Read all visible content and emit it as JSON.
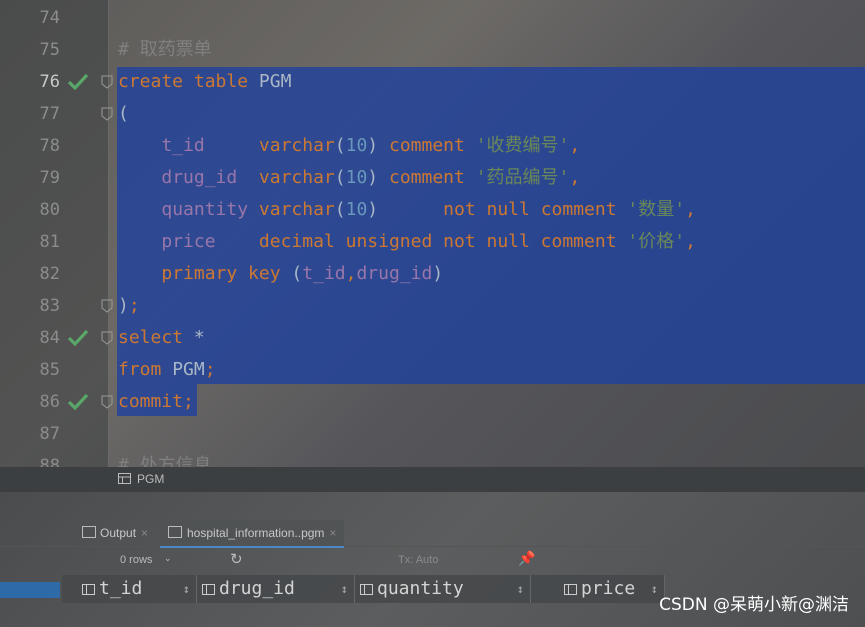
{
  "editor": {
    "lines": [
      {
        "num": "74",
        "tokens": []
      },
      {
        "num": "75",
        "tokens": [
          {
            "t": "# 取药票单",
            "c": "cmt"
          }
        ]
      },
      {
        "num": "76",
        "tokens": [
          {
            "t": "create",
            "c": "kw"
          },
          {
            "t": " ",
            "c": "plain"
          },
          {
            "t": "table",
            "c": "kw"
          },
          {
            "t": " PGM",
            "c": "plain"
          }
        ]
      },
      {
        "num": "77",
        "tokens": [
          {
            "t": "(",
            "c": "plain"
          }
        ]
      },
      {
        "num": "78",
        "tokens": [
          {
            "t": "    ",
            "c": "plain"
          },
          {
            "t": "t_id",
            "c": "id"
          },
          {
            "t": "     ",
            "c": "plain"
          },
          {
            "t": "varchar",
            "c": "fn"
          },
          {
            "t": "(",
            "c": "plain"
          },
          {
            "t": "10",
            "c": "num"
          },
          {
            "t": ") ",
            "c": "plain"
          },
          {
            "t": "comment",
            "c": "kw"
          },
          {
            "t": " ",
            "c": "plain"
          },
          {
            "t": "'收费编号'",
            "c": "str"
          },
          {
            "t": ",",
            "c": "kw"
          }
        ]
      },
      {
        "num": "79",
        "tokens": [
          {
            "t": "    ",
            "c": "plain"
          },
          {
            "t": "drug_id",
            "c": "id"
          },
          {
            "t": "  ",
            "c": "plain"
          },
          {
            "t": "varchar",
            "c": "fn"
          },
          {
            "t": "(",
            "c": "plain"
          },
          {
            "t": "10",
            "c": "num"
          },
          {
            "t": ") ",
            "c": "plain"
          },
          {
            "t": "comment",
            "c": "kw"
          },
          {
            "t": " ",
            "c": "plain"
          },
          {
            "t": "'药品编号'",
            "c": "str"
          },
          {
            "t": ",",
            "c": "kw"
          }
        ]
      },
      {
        "num": "80",
        "tokens": [
          {
            "t": "    ",
            "c": "plain"
          },
          {
            "t": "quantity",
            "c": "id"
          },
          {
            "t": " ",
            "c": "plain"
          },
          {
            "t": "varchar",
            "c": "fn"
          },
          {
            "t": "(",
            "c": "plain"
          },
          {
            "t": "10",
            "c": "num"
          },
          {
            "t": ")      ",
            "c": "plain"
          },
          {
            "t": "not null comment",
            "c": "kw"
          },
          {
            "t": " ",
            "c": "plain"
          },
          {
            "t": "'数量'",
            "c": "str"
          },
          {
            "t": ",",
            "c": "kw"
          }
        ]
      },
      {
        "num": "81",
        "tokens": [
          {
            "t": "    ",
            "c": "plain"
          },
          {
            "t": "price",
            "c": "id"
          },
          {
            "t": "    ",
            "c": "plain"
          },
          {
            "t": "decimal unsigned not null comment",
            "c": "kw"
          },
          {
            "t": " ",
            "c": "plain"
          },
          {
            "t": "'价格'",
            "c": "str"
          },
          {
            "t": ",",
            "c": "kw"
          }
        ]
      },
      {
        "num": "82",
        "tokens": [
          {
            "t": "    ",
            "c": "plain"
          },
          {
            "t": "primary key",
            "c": "kw"
          },
          {
            "t": " (",
            "c": "plain"
          },
          {
            "t": "t_id",
            "c": "id"
          },
          {
            "t": ",",
            "c": "kw"
          },
          {
            "t": "drug_id",
            "c": "id"
          },
          {
            "t": ")",
            "c": "plain"
          }
        ]
      },
      {
        "num": "83",
        "tokens": [
          {
            "t": ")",
            "c": "plain"
          },
          {
            "t": ";",
            "c": "kw"
          }
        ]
      },
      {
        "num": "84",
        "tokens": [
          {
            "t": "select",
            "c": "kw"
          },
          {
            "t": " *",
            "c": "plain"
          }
        ]
      },
      {
        "num": "85",
        "tokens": [
          {
            "t": "from",
            "c": "kw"
          },
          {
            "t": " PGM",
            "c": "plain"
          },
          {
            "t": ";",
            "c": "kw"
          }
        ]
      },
      {
        "num": "86",
        "tokens": [
          {
            "t": "commit",
            "c": "kw"
          },
          {
            "t": ";",
            "c": "kw"
          }
        ]
      },
      {
        "num": "87",
        "tokens": []
      },
      {
        "num": "88",
        "tokens": [
          {
            "t": "# 处方信息",
            "c": "cmt"
          }
        ]
      }
    ]
  },
  "breadcrumb": {
    "label": "PGM"
  },
  "tabs": [
    {
      "label": "Output"
    },
    {
      "label": "hospital_information..pgm"
    }
  ],
  "toolbar": {
    "rows": "0 rows",
    "tx": "Tx: Auto"
  },
  "grid": {
    "columns": [
      "t_id",
      "drug_id",
      "quantity",
      "price"
    ]
  },
  "watermark": "CSDN @呆萌小新@渊洁"
}
